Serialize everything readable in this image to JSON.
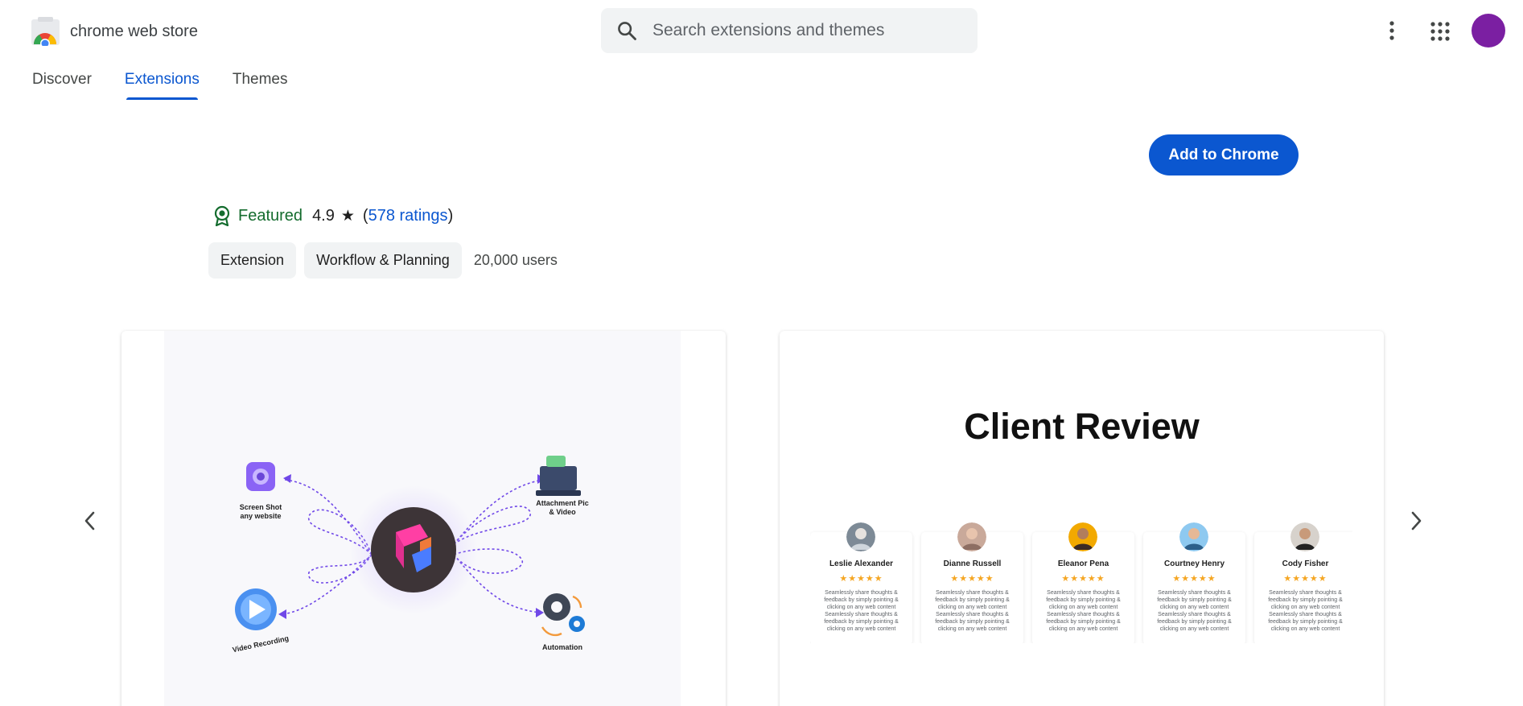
{
  "header": {
    "logo_text": "chrome web store",
    "search_placeholder": "Search extensions and themes"
  },
  "tabs": [
    {
      "label": "Discover",
      "active": false
    },
    {
      "label": "Extensions",
      "active": true
    },
    {
      "label": "Themes",
      "active": false
    }
  ],
  "actions": {
    "add_label": "Add to Chrome"
  },
  "meta": {
    "featured_label": "Featured",
    "rating": "4.9",
    "ratings_count_label": "578 ratings",
    "users": "20,000 users"
  },
  "chips": [
    "Extension",
    "Workflow & Planning"
  ],
  "colors": {
    "accent": "#0b57d0",
    "featured": "#146c2e",
    "avatar": "#7b1fa2",
    "stars": "#f5a623"
  },
  "carousel": {
    "slide1": {
      "labels": [
        "Screen Shot any website",
        "Attachment Pic & Video",
        "Video Recording",
        "Automation"
      ]
    },
    "slide2": {
      "title": "Client Review",
      "reviews": [
        {
          "name": "Leslie Alexander",
          "stars": "★★★★★",
          "text": "Seamlessly share thoughts & feedback by simply pointing & clicking on any web content Seamlessly share thoughts & feedback by simply pointing & clicking on any web content"
        },
        {
          "name": "Dianne Russell",
          "stars": "★★★★★",
          "text": "Seamlessly share thoughts & feedback by simply pointing & clicking on any web content Seamlessly share thoughts & feedback by simply pointing & clicking on any web content"
        },
        {
          "name": "Eleanor Pena",
          "stars": "★★★★★",
          "text": "Seamlessly share thoughts & feedback by simply pointing & clicking on any web content Seamlessly share thoughts & feedback by simply pointing & clicking on any web content"
        },
        {
          "name": "Courtney Henry",
          "stars": "★★★★★",
          "text": "Seamlessly share thoughts & feedback by simply pointing & clicking on any web content Seamlessly share thoughts & feedback by simply pointing & clicking on any web content"
        },
        {
          "name": "Cody Fisher",
          "stars": "★★★★★",
          "text": "Seamlessly share thoughts & feedback by simply pointing & clicking on any web content Seamlessly share thoughts & feedback by simply pointing & clicking on any web content"
        }
      ]
    }
  }
}
